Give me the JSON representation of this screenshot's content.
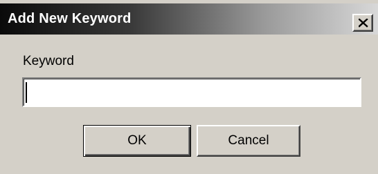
{
  "dialog": {
    "title": "Add New Keyword",
    "close_icon": "close-x-icon",
    "keyword_label": "Keyword",
    "keyword_value": "",
    "keyword_placeholder": "",
    "ok_label": "OK",
    "cancel_label": "Cancel"
  },
  "colors": {
    "face": "#d4d0c8",
    "titlebar_start": "#0a0a0a",
    "titlebar_end": "#d8d8d8",
    "title_text": "#ffffff"
  }
}
